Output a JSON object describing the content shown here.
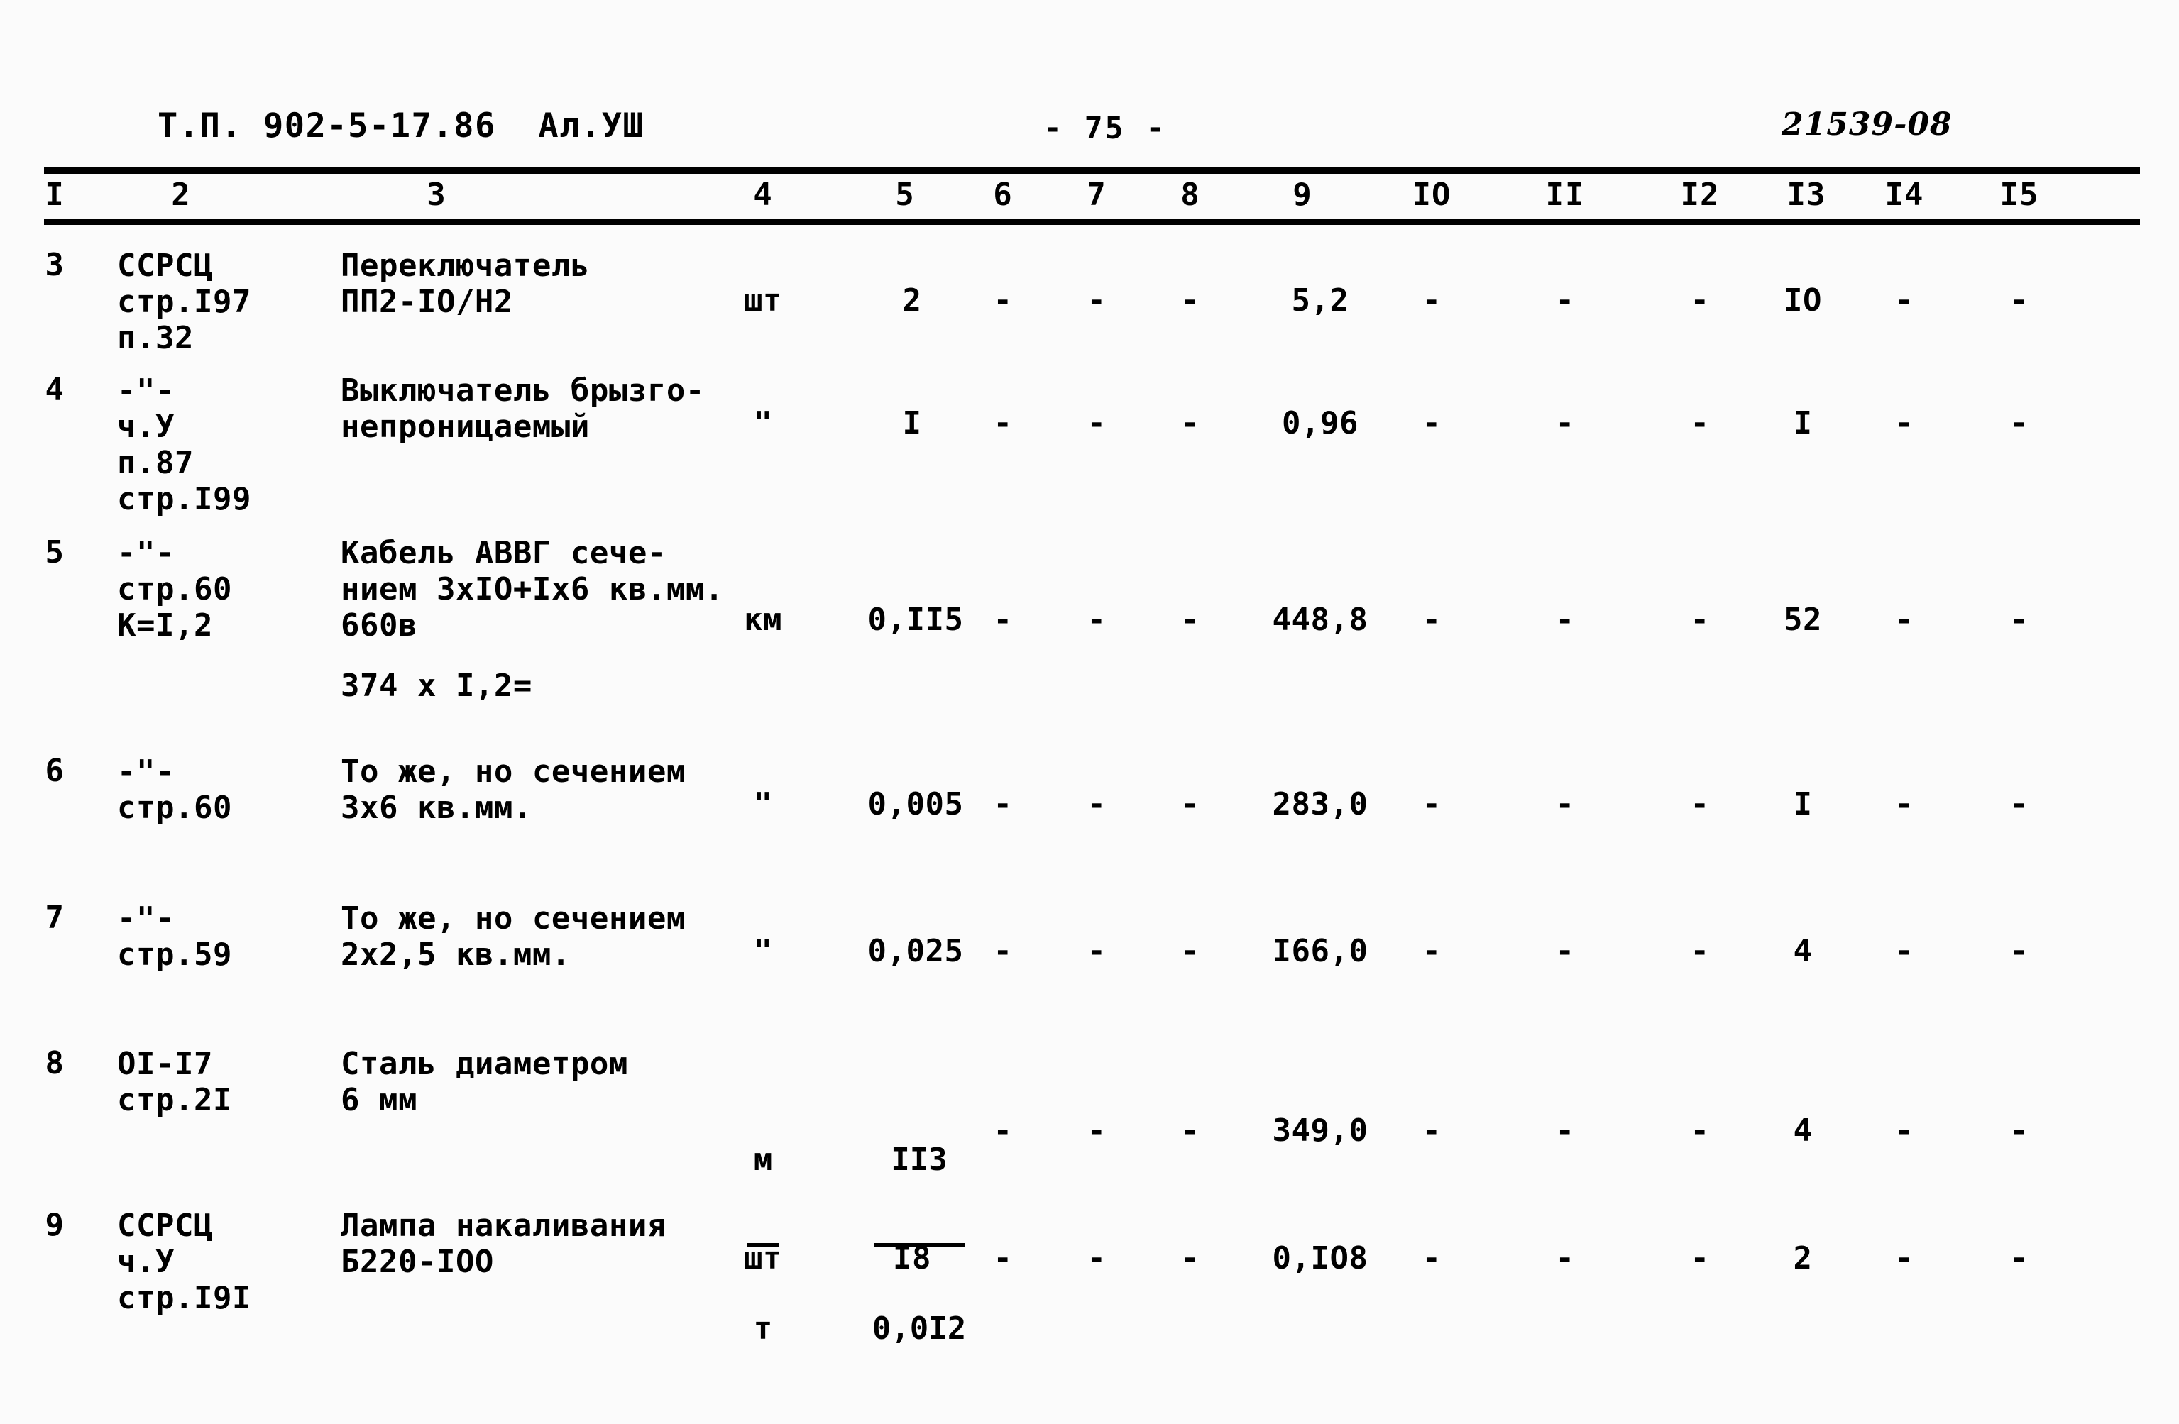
{
  "header": {
    "left": "Т.П. 902-5-17.86  Ал.УШ",
    "page_number": "- 75 -",
    "stamp": "21539-08"
  },
  "table": {
    "column_headers": [
      "I",
      "2",
      "3",
      "4",
      "5",
      "6",
      "7",
      "8",
      "9",
      "IO",
      "II",
      "I2",
      "I3",
      "I4",
      "I5"
    ],
    "rows": [
      {
        "num": "3",
        "code": "ССРСЦ\nстр.I97\nп.32",
        "name": "Переключатель\nПП2-IO/Н2",
        "unit": "шт",
        "c5": "2",
        "c6": "-",
        "c7": "-",
        "c8": "-",
        "c9": "5,2",
        "c10": "-",
        "c11": "-",
        "c12": "-",
        "c13": "IO",
        "c14": "-",
        "c15": "-"
      },
      {
        "num": "4",
        "code": "-\"-\nч.У\nп.87\nстр.I99",
        "name": "Выключатель брызго-\nнепроницаемый",
        "unit": "\"",
        "c5": "I",
        "c6": "-",
        "c7": "-",
        "c8": "-",
        "c9": "0,96",
        "c10": "-",
        "c11": "-",
        "c12": "-",
        "c13": "I",
        "c14": "-",
        "c15": "-"
      },
      {
        "num": "5",
        "code": "-\"-\nстр.60\nК=I,2",
        "name": "Кабель АВВГ сече-\nнием 3хIO+Iх6 кв.мм.\n660в",
        "name_extra": "374 х I,2=",
        "unit": "км",
        "c5": "0,II5",
        "c6": "-",
        "c7": "-",
        "c8": "-",
        "c9": "448,8",
        "c10": "-",
        "c11": "-",
        "c12": "-",
        "c13": "52",
        "c14": "-",
        "c15": "-"
      },
      {
        "num": "6",
        "code": "-\"-\nстр.60",
        "name": "То же, но сечением\n3х6 кв.мм.",
        "unit": "\"",
        "c5": "0,005",
        "c6": "-",
        "c7": "-",
        "c8": "-",
        "c9": "283,0",
        "c10": "-",
        "c11": "-",
        "c12": "-",
        "c13": "I",
        "c14": "-",
        "c15": "-"
      },
      {
        "num": "7",
        "code": "-\"-\nстр.59",
        "name": "То же, но сечением\n2х2,5 кв.мм.",
        "unit": "\"",
        "c5": "0,025",
        "c6": "-",
        "c7": "-",
        "c8": "-",
        "c9": "I66,0",
        "c10": "-",
        "c11": "-",
        "c12": "-",
        "c13": "4",
        "c14": "-",
        "c15": "-"
      },
      {
        "num": "8",
        "code": "OI-I7\nстр.2I",
        "name": "Сталь диаметром\n6 мм",
        "unit_frac_top": "м",
        "unit_frac_bottom": "т",
        "c5_frac_top": "II3",
        "c5_frac_bottom": "0,0I2",
        "c6": "-",
        "c7": "-",
        "c8": "-",
        "c9": "349,0",
        "c10": "-",
        "c11": "-",
        "c12": "-",
        "c13": "4",
        "c14": "-",
        "c15": "-"
      },
      {
        "num": "9",
        "code": "ССРСЦ\nч.У\nстр.I9I",
        "name": "Лампа накаливания\nБ220-IOO",
        "unit": "шт",
        "c5": "I8",
        "c6": "-",
        "c7": "-",
        "c8": "-",
        "c9": "0,IO8",
        "c10": "-",
        "c11": "-",
        "c12": "-",
        "c13": "2",
        "c14": "-",
        "c15": "-"
      }
    ]
  }
}
